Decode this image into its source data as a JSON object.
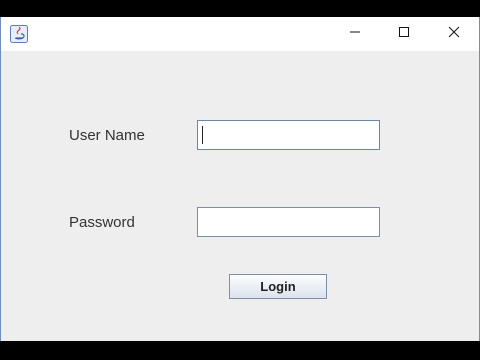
{
  "window": {
    "icon": "java-icon",
    "controls": {
      "minimize_icon": "minimize-icon",
      "maximize_icon": "maximize-icon",
      "close_icon": "close-icon"
    }
  },
  "form": {
    "username_label": "User Name",
    "username_value": "",
    "password_label": "Password",
    "password_value": "",
    "login_label": "Login"
  },
  "colors": {
    "content_background": "#eeeeee",
    "titlebar_background": "#ffffff",
    "field_border": "#7a8ea8"
  }
}
